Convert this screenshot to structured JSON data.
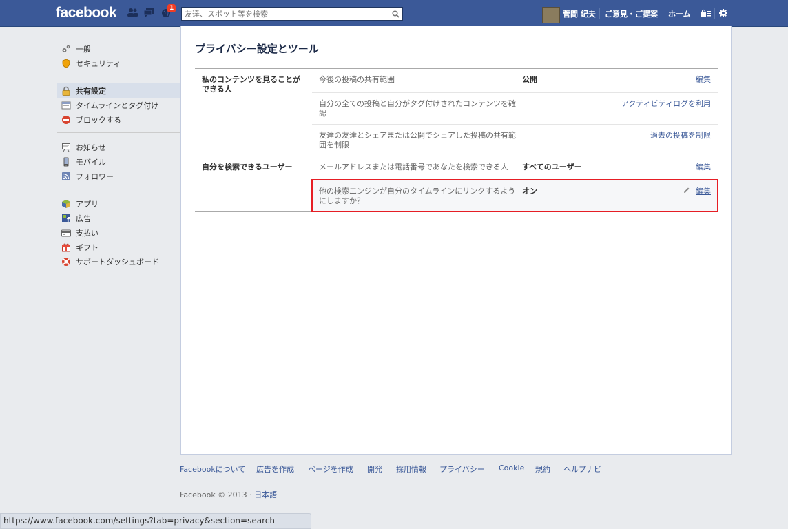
{
  "header": {
    "logo": "facebook",
    "notification_count": "1",
    "search_placeholder": "友達、スポット等を検索",
    "user_name": "菅間 紀夫",
    "feedback_link": "ご意見・ご提案",
    "home_link": "ホーム",
    "icons": [
      "friend-requests-icon",
      "messages-icon",
      "notifications-globe-icon",
      "search-icon",
      "privacy-shortcuts-icon",
      "settings-gear-icon"
    ]
  },
  "sidebar": {
    "groups": [
      [
        {
          "label": "一般",
          "icon": "gears-icon"
        },
        {
          "label": "セキュリティ",
          "icon": "shield-icon"
        }
      ],
      [
        {
          "label": "共有設定",
          "icon": "lock-icon",
          "active": true
        },
        {
          "label": "タイムラインとタグ付け",
          "icon": "timeline-icon"
        },
        {
          "label": "ブロックする",
          "icon": "block-icon"
        }
      ],
      [
        {
          "label": "お知らせ",
          "icon": "notification-icon"
        },
        {
          "label": "モバイル",
          "icon": "mobile-icon"
        },
        {
          "label": "フォロワー",
          "icon": "rss-icon"
        }
      ],
      [
        {
          "label": "アプリ",
          "icon": "apps-icon"
        },
        {
          "label": "広告",
          "icon": "ads-icon"
        },
        {
          "label": "支払い",
          "icon": "card-icon"
        },
        {
          "label": "ギフト",
          "icon": "gift-icon"
        },
        {
          "label": "サポートダッシュボード",
          "icon": "lifebuoy-icon"
        }
      ]
    ]
  },
  "main": {
    "title": "プライバシー設定とツール",
    "sections": [
      {
        "label": "私のコンテンツを見ることができる人",
        "rows": [
          {
            "desc": "今後の投稿の共有範囲",
            "value": "公開",
            "action": "編集"
          },
          {
            "desc": "自分の全ての投稿と自分がタグ付けされたコンテンツを確認",
            "value": "",
            "action": "アクティビティログを利用"
          },
          {
            "desc": "友達の友達とシェアまたは公開でシェアした投稿の共有範囲を制限",
            "value": "",
            "action": "過去の投稿を制限"
          }
        ]
      },
      {
        "label": "自分を検索できるユーザー",
        "rows": [
          {
            "desc": "メールアドレスまたは電話番号であなたを検索できる人",
            "value": "すべてのユーザー",
            "action": "編集"
          },
          {
            "desc": "他の検索エンジンが自分のタイムラインにリンクするようにしますか？",
            "value": "オン",
            "action": "編集",
            "highlighted": true
          }
        ]
      }
    ]
  },
  "footer": {
    "links": [
      "Facebookについて",
      "広告を作成",
      "ページを作成",
      "開発",
      "採用情報",
      "プライバシー",
      "Cookie",
      "規約",
      "ヘルプナビ"
    ],
    "copyright": "Facebook © 2013 ·",
    "language": "日本語"
  },
  "status_bar": {
    "url": "https://www.facebook.com/settings?tab=privacy&section=search"
  },
  "colors": {
    "brand": "#3b5998",
    "highlight_border": "#e61e25",
    "active_nav": "#d8dfea"
  }
}
